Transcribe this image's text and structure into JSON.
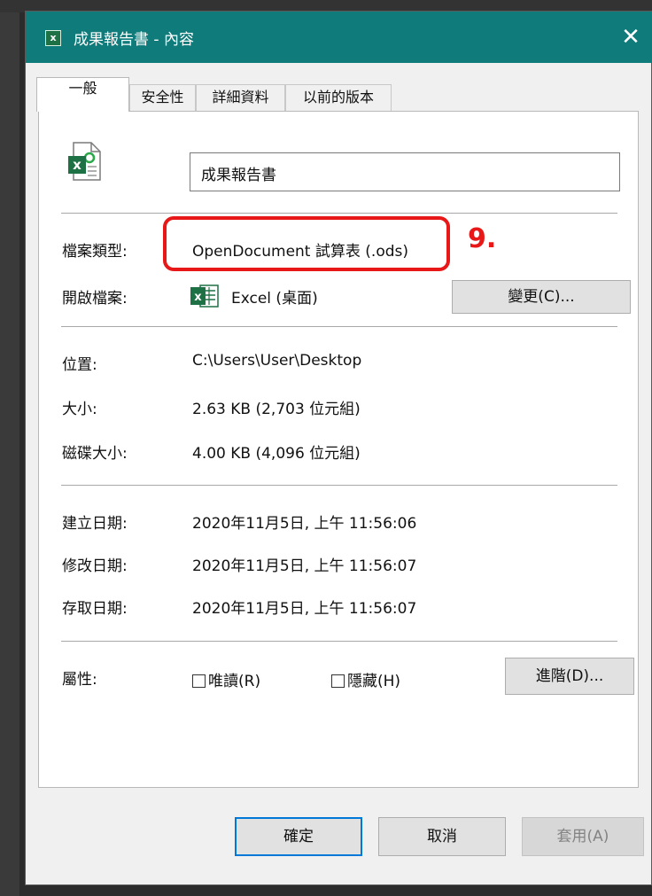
{
  "window": {
    "title": "成果報告書 - 內容",
    "close_glyph": "✕",
    "app_badge": "x"
  },
  "tabs": [
    {
      "label": "一般"
    },
    {
      "label": "安全性"
    },
    {
      "label": "詳細資料"
    },
    {
      "label": "以前的版本"
    }
  ],
  "general": {
    "file_name": "成果報告書",
    "file_type": {
      "label": "檔案類型:",
      "value": "OpenDocument 試算表 (.ods)"
    },
    "opens_with": {
      "label": "開啟檔案:",
      "value": "Excel (桌面)",
      "change_button": "變更(C)..."
    },
    "location": {
      "label": "位置:",
      "value": "C:\\Users\\User\\Desktop"
    },
    "size": {
      "label": "大小:",
      "value": "2.63 KB (2,703 位元組)"
    },
    "size_on_disk": {
      "label": "磁碟大小:",
      "value": "4.00 KB (4,096 位元組)"
    },
    "created": {
      "label": "建立日期:",
      "value": "2020年11月5日, 上午 11:56:06"
    },
    "modified": {
      "label": "修改日期:",
      "value": "2020年11月5日, 上午 11:56:07"
    },
    "accessed": {
      "label": "存取日期:",
      "value": "2020年11月5日, 上午 11:56:07"
    },
    "attributes": {
      "label": "屬性:",
      "readonly": {
        "label": "唯讀(R)",
        "checked": false
      },
      "hidden": {
        "label": "隱藏(H)",
        "checked": false
      },
      "advanced_button": "進階(D)..."
    }
  },
  "annotation": {
    "label": "9.",
    "color": "#e81818"
  },
  "footer": {
    "ok": "確定",
    "cancel": "取消",
    "apply": "套用(A)"
  },
  "colors": {
    "titlebar": "#0f7b7b",
    "excel_green": "#1e7145",
    "primary_button_border": "#0078d7"
  }
}
